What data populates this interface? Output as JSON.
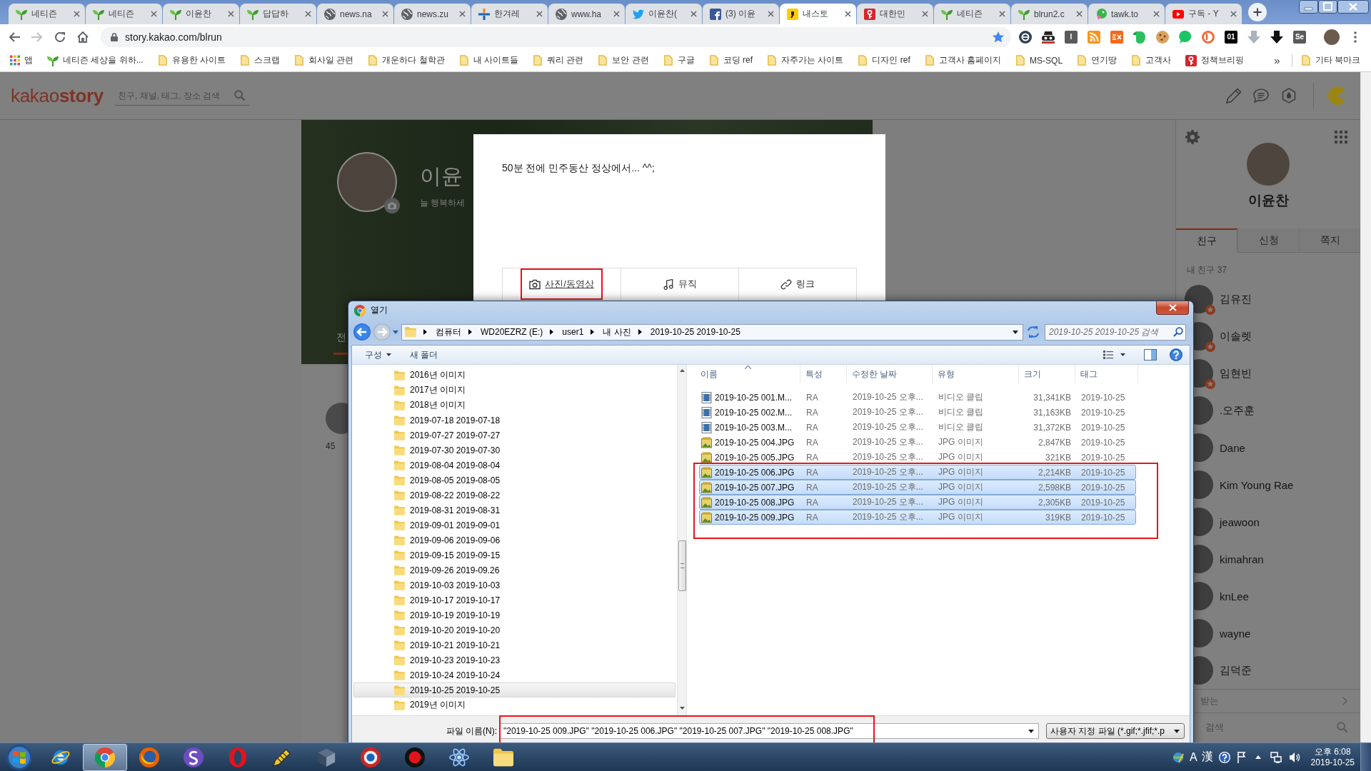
{
  "browser": {
    "tabs": [
      {
        "kind": "sprout",
        "title": "네티즌",
        "selected": false
      },
      {
        "kind": "sprout",
        "title": "네티즌",
        "selected": false
      },
      {
        "kind": "sprout",
        "title": "이윤찬",
        "selected": false
      },
      {
        "kind": "sprout",
        "title": "답답하",
        "selected": false
      },
      {
        "kind": "globe",
        "title": "news.na",
        "selected": false
      },
      {
        "kind": "globe",
        "title": "news.zu",
        "selected": false
      },
      {
        "kind": "cross",
        "title": "한겨레",
        "selected": false
      },
      {
        "kind": "globe",
        "title": "www.ha",
        "selected": false
      },
      {
        "kind": "bird",
        "title": "이윤찬(",
        "selected": false
      },
      {
        "kind": "fbook",
        "title": "(3) 이윤",
        "selected": false
      },
      {
        "kind": "story",
        "title": "내스토",
        "selected": true
      },
      {
        "kind": "flag",
        "title": "대한민",
        "selected": false
      },
      {
        "kind": "sprout",
        "title": "네티즌",
        "selected": false
      },
      {
        "kind": "sprout",
        "title": "blrun2.c",
        "selected": false
      },
      {
        "kind": "tawk",
        "title": "tawk.to",
        "selected": false
      },
      {
        "kind": "play",
        "title": "구독 - Y",
        "selected": false
      }
    ],
    "url": "story.kakao.com/blrun",
    "extensions": [
      {
        "kind": "disc"
      },
      {
        "kind": "mask"
      },
      {
        "kind": "gtile",
        "text": "I"
      },
      {
        "kind": "rss"
      },
      {
        "kind": "ex"
      },
      {
        "kind": "elephant"
      },
      {
        "kind": "cookie"
      },
      {
        "kind": "bubble"
      },
      {
        "kind": "ring"
      },
      {
        "kind": "btile",
        "text": "01"
      },
      {
        "kind": "down"
      },
      {
        "kind": "arrow"
      },
      {
        "kind": "gtile",
        "text": "Se"
      }
    ]
  },
  "bookmarks": {
    "items": [
      {
        "kind": "apps",
        "label": "앱"
      },
      {
        "kind": "sprout",
        "label": "네티즌 세상을 위하..."
      },
      {
        "kind": "folder",
        "label": "유용한 사이트"
      },
      {
        "kind": "folder",
        "label": "스크랩"
      },
      {
        "kind": "folder",
        "label": "회사일 관련"
      },
      {
        "kind": "folder",
        "label": "개운하다 철학관"
      },
      {
        "kind": "folder",
        "label": "내 사이트들"
      },
      {
        "kind": "folder",
        "label": "쿼리 관련"
      },
      {
        "kind": "folder",
        "label": "보안 관련"
      },
      {
        "kind": "folder",
        "label": "구글"
      },
      {
        "kind": "folder",
        "label": "코딩 ref"
      },
      {
        "kind": "folder",
        "label": "자주가는 사이트"
      },
      {
        "kind": "folder",
        "label": "디자인 ref"
      },
      {
        "kind": "folder",
        "label": "고객사 홈페이지"
      },
      {
        "kind": "folder",
        "label": "MS-SQL"
      },
      {
        "kind": "folder",
        "label": "연기땅"
      },
      {
        "kind": "folder",
        "label": "고객사"
      },
      {
        "kind": "flag",
        "label": "정책브리핑"
      }
    ],
    "overflow": "»",
    "other": {
      "kind": "folder",
      "label": "기타 북마크"
    }
  },
  "kakao": {
    "logo": "kakao**story**",
    "search_placeholder": "친구, 채널, 태그, 장소 검색",
    "profile": {
      "name": "이윤",
      "status": "늘 행복하세"
    },
    "profile_tabs": [
      {
        "label": "전",
        "selected": true
      }
    ],
    "card_text": "45",
    "post_editor": {
      "text": "50분 전에 민주동산 정상에서... ^^;",
      "buttons": [
        {
          "kind": "photo",
          "label": "사진/동영상",
          "hovered": true,
          "highlight_box": true
        },
        {
          "kind": "music",
          "label": "뮤직",
          "hovered": false,
          "highlight_box": false
        },
        {
          "kind": "link",
          "label": "링크",
          "hovered": false,
          "highlight_box": false
        }
      ]
    },
    "sidebar": {
      "name": "이윤찬",
      "tabs": [
        {
          "label": "친구",
          "selected": true
        },
        {
          "label": "신청",
          "selected": false
        },
        {
          "label": "쪽지",
          "selected": false
        }
      ],
      "friend_count": "내 친구 37",
      "friends": [
        {
          "name": "김유진",
          "favorite": true
        },
        {
          "name": "이솔렛",
          "favorite": true
        },
        {
          "name": "임현빈",
          "favorite": true
        },
        {
          "name": ".오주훈",
          "favorite": false
        },
        {
          "name": "Dane",
          "favorite": false
        },
        {
          "name": "Kim Young Rae",
          "favorite": false
        },
        {
          "name": "jeawoon",
          "favorite": false
        },
        {
          "name": "kimahran",
          "favorite": false
        },
        {
          "name": "knLee",
          "favorite": false
        },
        {
          "name": "wayne",
          "favorite": false
        },
        {
          "name": "김덕준",
          "favorite": false
        }
      ],
      "footer": [
        {
          "kind": "chevron",
          "label": "받는"
        },
        {
          "kind": "search",
          "label": "검색"
        }
      ]
    }
  },
  "dialog": {
    "title": "열기",
    "breadcrumb": [
      "컴퓨터",
      "WD20EZRZ (E:)",
      "user1",
      "내 사진",
      "2019-10-25 2019-10-25"
    ],
    "search_placeholder": "2019-10-25 2019-10-25 검색",
    "toolbar": [
      {
        "label": "구성",
        "dropdown": true
      },
      {
        "label": "새 폴더",
        "dropdown": false
      }
    ],
    "folders": [
      {
        "label": "2016년 이미지",
        "selected": false
      },
      {
        "label": "2017년 이미지",
        "selected": false
      },
      {
        "label": "2018년 이미지",
        "selected": false
      },
      {
        "label": "2019-07-18 2019-07-18",
        "selected": false
      },
      {
        "label": "2019-07-27 2019-07-27",
        "selected": false
      },
      {
        "label": "2019-07-30 2019-07-30",
        "selected": false
      },
      {
        "label": "2019-08-04 2019-08-04",
        "selected": false
      },
      {
        "label": "2019-08-05 2019-08-05",
        "selected": false
      },
      {
        "label": "2019-08-22 2019-08-22",
        "selected": false
      },
      {
        "label": "2019-08-31 2019-08-31",
        "selected": false
      },
      {
        "label": "2019-09-01 2019-09-01",
        "selected": false
      },
      {
        "label": "2019-09-06 2019-09-06",
        "selected": false
      },
      {
        "label": "2019-09-15 2019-09-15",
        "selected": false
      },
      {
        "label": "2019-09-26 2019-09.26",
        "selected": false
      },
      {
        "label": "2019-10-03 2019-10-03",
        "selected": false
      },
      {
        "label": "2019-10-17 2019-10-17",
        "selected": false
      },
      {
        "label": "2019-10-19 2019-10-19",
        "selected": false
      },
      {
        "label": "2019-10-20 2019-10-20",
        "selected": false
      },
      {
        "label": "2019-10-21 2019-10-21",
        "selected": false
      },
      {
        "label": "2019-10-23 2019-10-23",
        "selected": false
      },
      {
        "label": "2019-10-24 2019-10-24",
        "selected": false
      },
      {
        "label": "2019-10-25 2019-10-25",
        "selected": true
      },
      {
        "label": "2019년 이미지",
        "selected": false
      }
    ],
    "columns": [
      {
        "label": "이름",
        "sorted": true
      },
      {
        "label": "특성",
        "sorted": false
      },
      {
        "label": "수정한 날짜",
        "sorted": false
      },
      {
        "label": "유형",
        "sorted": false
      },
      {
        "label": "크기",
        "sorted": false
      },
      {
        "label": "태그",
        "sorted": false
      }
    ],
    "files": [
      {
        "kind": "video",
        "name": "2019-10-25 001.M...",
        "attr": "RA",
        "modified": "2019-10-25 오후...",
        "type": "비디오 클립",
        "size": "31,341KB",
        "tag": "2019-10-25",
        "selected": false
      },
      {
        "kind": "video",
        "name": "2019-10-25 002.M...",
        "attr": "RA",
        "modified": "2019-10-25 오후...",
        "type": "비디오 클립",
        "size": "31,163KB",
        "tag": "2019-10-25",
        "selected": false
      },
      {
        "kind": "video",
        "name": "2019-10-25 003.M...",
        "attr": "RA",
        "modified": "2019-10-25 오후...",
        "type": "비디오 클립",
        "size": "31,372KB",
        "tag": "2019-10-25",
        "selected": false
      },
      {
        "kind": "image",
        "name": "2019-10-25 004.JPG",
        "attr": "RA",
        "modified": "2019-10-25 오후...",
        "type": "JPG 이미지",
        "size": "2,847KB",
        "tag": "2019-10-25",
        "selected": false
      },
      {
        "kind": "image",
        "name": "2019-10-25 005.JPG",
        "attr": "RA",
        "modified": "2019-10-25 오후...",
        "type": "JPG 이미지",
        "size": "321KB",
        "tag": "2019-10-25",
        "selected": false
      },
      {
        "kind": "image",
        "name": "2019-10-25 006.JPG",
        "attr": "RA",
        "modified": "2019-10-25 오후...",
        "type": "JPG 이미지",
        "size": "2,214KB",
        "tag": "2019-10-25",
        "selected": true
      },
      {
        "kind": "image",
        "name": "2019-10-25 007.JPG",
        "attr": "RA",
        "modified": "2019-10-25 오후...",
        "type": "JPG 이미지",
        "size": "2,598KB",
        "tag": "2019-10-25",
        "selected": true
      },
      {
        "kind": "image",
        "name": "2019-10-25 008.JPG",
        "attr": "RA",
        "modified": "2019-10-25 오후...",
        "type": "JPG 이미지",
        "size": "2,305KB",
        "tag": "2019-10-25",
        "selected": true
      },
      {
        "kind": "image",
        "name": "2019-10-25 009.JPG",
        "attr": "RA",
        "modified": "2019-10-25 오후...",
        "type": "JPG 이미지",
        "size": "319KB",
        "tag": "2019-10-25",
        "selected": true
      }
    ],
    "files_highlight_box": true,
    "filename_label": "파일 이름(N):",
    "filename": "\"2019-10-25 009.JPG\" \"2019-10-25 006.JPG\" \"2019-10-25 007.JPG\" \"2019-10-25 008.JPG\"",
    "filename_highlight_box": true,
    "filter": "사용자 지정 파일 (*.gif;*.jfif;*.p"
  },
  "taskbar": {
    "apps": [
      {
        "kind": "ie",
        "selected": false
      },
      {
        "kind": "chrome",
        "selected": true
      },
      {
        "kind": "firefox",
        "selected": false
      },
      {
        "kind": "swirl",
        "selected": false
      },
      {
        "kind": "opera",
        "selected": false
      },
      {
        "kind": "pen",
        "selected": false
      },
      {
        "kind": "book",
        "selected": false
      },
      {
        "kind": "disc",
        "selected": false
      },
      {
        "kind": "record",
        "selected": false
      },
      {
        "kind": "atom",
        "selected": false
      },
      {
        "kind": "folder",
        "selected": false
      }
    ],
    "ime": [
      "A",
      "漢"
    ],
    "time": "오후 6:08",
    "date": "2019-10-25"
  }
}
